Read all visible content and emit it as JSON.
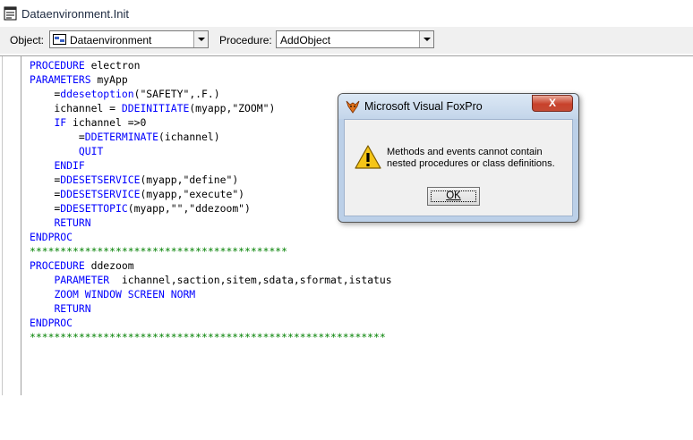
{
  "window": {
    "title": "Dataenvironment.Init"
  },
  "toolbar": {
    "object_label": "Object:",
    "object_value": "Dataenvironment",
    "procedure_label": "Procedure:",
    "procedure_value": "AddObject"
  },
  "code_lines": [
    [
      {
        "c": "kw",
        "t": "PROCEDURE"
      },
      {
        "c": "tx",
        "t": " electron"
      }
    ],
    [
      {
        "c": "kw",
        "t": "PARAMETERS"
      },
      {
        "c": "tx",
        "t": " myApp"
      }
    ],
    [
      {
        "c": "tx",
        "t": "    ="
      },
      {
        "c": "kw",
        "t": "ddesetoption"
      },
      {
        "c": "tx",
        "t": "(\"SAFETY\",.F.)"
      }
    ],
    [
      {
        "c": "tx",
        "t": "    ichannel = "
      },
      {
        "c": "kw",
        "t": "DDEINITIATE"
      },
      {
        "c": "tx",
        "t": "(myapp,\"ZOOM\")"
      }
    ],
    [
      {
        "c": "tx",
        "t": "    "
      },
      {
        "c": "kw",
        "t": "IF"
      },
      {
        "c": "tx",
        "t": " ichannel =>0"
      }
    ],
    [
      {
        "c": "tx",
        "t": "        ="
      },
      {
        "c": "kw",
        "t": "DDETERMINATE"
      },
      {
        "c": "tx",
        "t": "(ichannel)"
      }
    ],
    [
      {
        "c": "tx",
        "t": "        "
      },
      {
        "c": "kw",
        "t": "QUIT"
      }
    ],
    [
      {
        "c": "tx",
        "t": "    "
      },
      {
        "c": "kw",
        "t": "ENDIF"
      }
    ],
    [
      {
        "c": "tx",
        "t": "    ="
      },
      {
        "c": "kw",
        "t": "DDESETSERVICE"
      },
      {
        "c": "tx",
        "t": "(myapp,\"define\")"
      }
    ],
    [
      {
        "c": "tx",
        "t": "    ="
      },
      {
        "c": "kw",
        "t": "DDESETSERVICE"
      },
      {
        "c": "tx",
        "t": "(myapp,\"execute\")"
      }
    ],
    [
      {
        "c": "tx",
        "t": "    ="
      },
      {
        "c": "kw",
        "t": "DDESETTOPIC"
      },
      {
        "c": "tx",
        "t": "(myapp,\"\",\"ddezoom\")"
      }
    ],
    [
      {
        "c": "tx",
        "t": "    "
      },
      {
        "c": "kw",
        "t": "RETURN"
      }
    ],
    [
      {
        "c": "kw",
        "t": "ENDPROC"
      }
    ],
    [
      {
        "c": "cm",
        "t": "******************************************"
      }
    ],
    [
      {
        "c": "kw",
        "t": "PROCEDURE"
      },
      {
        "c": "tx",
        "t": " ddezoom"
      }
    ],
    [
      {
        "c": "tx",
        "t": "    "
      },
      {
        "c": "kw",
        "t": "PARAMETER"
      },
      {
        "c": "tx",
        "t": "  ichannel,saction,sitem,sdata,sformat,istatus"
      }
    ],
    [
      {
        "c": "tx",
        "t": "    "
      },
      {
        "c": "kw",
        "t": "ZOOM WINDOW SCREEN NORM"
      }
    ],
    [
      {
        "c": "tx",
        "t": "    "
      },
      {
        "c": "kw",
        "t": "RETURN"
      }
    ],
    [
      {
        "c": "kw",
        "t": "ENDPROC"
      }
    ],
    [
      {
        "c": "cm",
        "t": "**********************************************************"
      }
    ]
  ],
  "dialog": {
    "title": "Microsoft Visual FoxPro",
    "close_label": "X",
    "message_line1": "Methods and events cannot contain",
    "message_line2": "nested procedures or class definitions.",
    "ok_label": "OK"
  },
  "colors": {
    "keyword": "#0000ff",
    "comment": "#008000",
    "text": "#000000"
  },
  "icons": {
    "title_icon": "form-icon",
    "object_icon": "dataenvironment-icon",
    "dialog_icon": "foxpro-icon",
    "message_icon": "warning-icon"
  }
}
